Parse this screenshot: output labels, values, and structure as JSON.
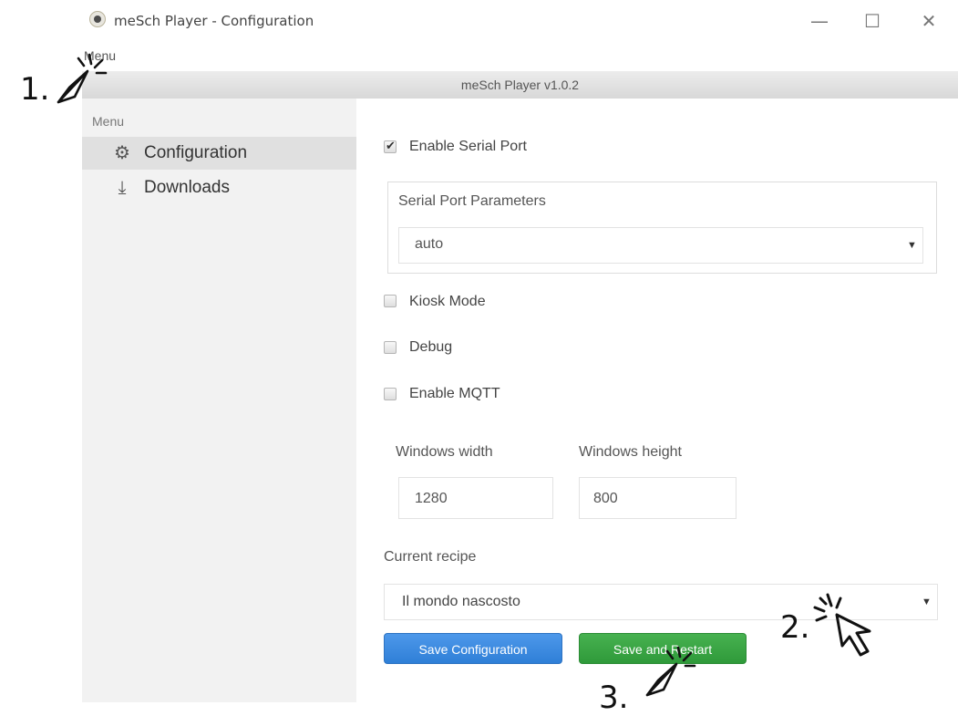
{
  "window": {
    "title": "meSch Player - Configuration",
    "minimize_glyph": "—",
    "maximize_glyph": "☐",
    "close_glyph": "✕",
    "icon": "app-logo-icon"
  },
  "menubar": {
    "label": "Menu"
  },
  "version": {
    "text": "meSch Player v1.0.2"
  },
  "sidebar": {
    "heading": "Menu",
    "items": [
      {
        "label": "Configuration",
        "icon": "gear-icon",
        "glyph": "⚙",
        "active": true
      },
      {
        "label": "Downloads",
        "icon": "download-icon",
        "glyph": "⤓",
        "active": false
      }
    ]
  },
  "config": {
    "enable_serial": {
      "label": "Enable Serial Port",
      "checked": true,
      "check_glyph": "✔"
    },
    "serial_params": {
      "title": "Serial Port Parameters",
      "value": "auto",
      "arrow": "▼"
    },
    "kiosk": {
      "label": "Kiosk Mode",
      "checked": false
    },
    "debug": {
      "label": "Debug",
      "checked": false
    },
    "mqtt": {
      "label": "Enable MQTT",
      "checked": false
    },
    "window_width": {
      "label": "Windows width",
      "value": "1280"
    },
    "window_height": {
      "label": "Windows height",
      "value": "800"
    },
    "recipe": {
      "label": "Current recipe",
      "value": "Il mondo nascosto",
      "arrow": "▼"
    },
    "save_button": "Save Configuration",
    "save_restart_button": "Save and Restart"
  },
  "annotations": [
    {
      "number": "1.",
      "icon": "click-cursor-icon"
    },
    {
      "number": "2.",
      "icon": "pointer-cursor-icon"
    },
    {
      "number": "3.",
      "icon": "click-cursor-icon"
    }
  ],
  "colors": {
    "primary_button": "#3a8ae0",
    "success_button": "#3ca646",
    "sidebar_bg": "#f2f2f2",
    "sidebar_active": "#e0e0e0"
  }
}
